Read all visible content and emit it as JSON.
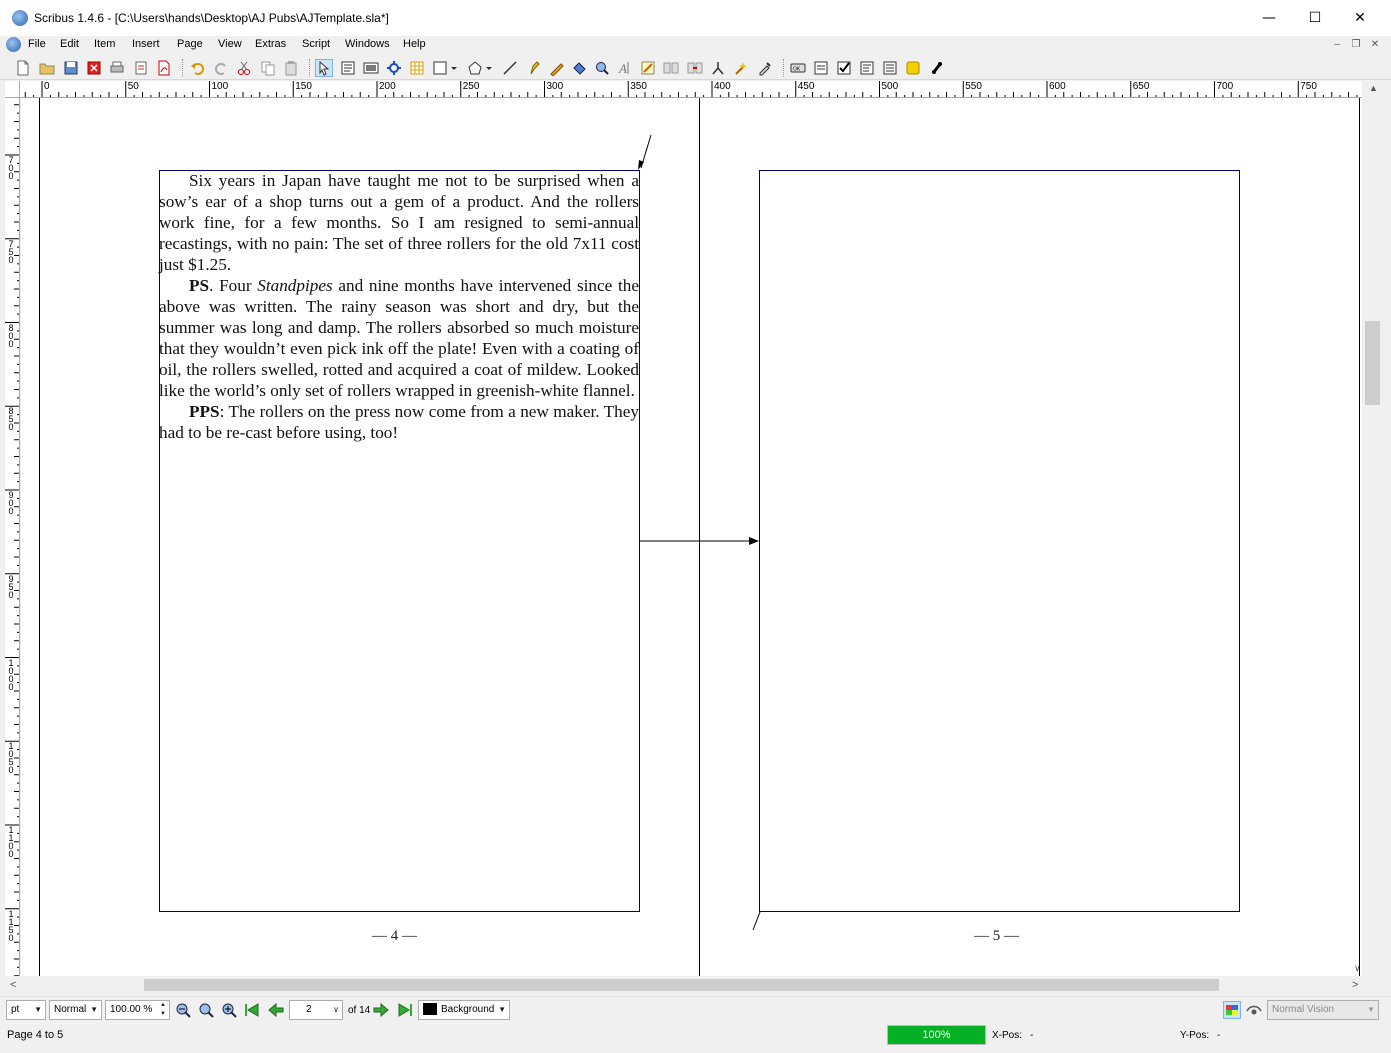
{
  "window": {
    "title": "Scribus 1.4.6 - [C:\\Users\\hands\\Desktop\\AJ Pubs\\AJTemplate.sla*]",
    "minimize_glyph": "—",
    "maximize_glyph": "☐",
    "close_glyph": "✕"
  },
  "menubar": {
    "items": [
      "File",
      "Edit",
      "Item",
      "Insert",
      "Page",
      "View",
      "Extras",
      "Script",
      "Windows",
      "Help"
    ]
  },
  "toolbar": {
    "icons": [
      "new-document-icon",
      "open-icon",
      "save-icon",
      "close-document-icon",
      "print-icon",
      "preflight-icon",
      "export-pdf-icon",
      "undo-icon",
      "redo-icon",
      "cut-icon",
      "copy-icon",
      "paste-icon",
      "select-icon",
      "text-frame-icon",
      "image-frame-icon",
      "render-frame-icon",
      "table-icon",
      "shape-icon",
      "polygon-icon",
      "line-icon",
      "bezier-icon",
      "freehand-icon",
      "rotate-icon",
      "zoom-icon",
      "edit-contents-icon",
      "edit-text-icon",
      "link-frames-icon",
      "unlink-frames-icon",
      "measure-icon",
      "copy-properties-icon",
      "eyedropper-icon",
      "pdf-button-icon",
      "pdf-textfield-icon",
      "pdf-checkbox-icon",
      "pdf-combobox-icon",
      "pdf-listbox-icon",
      "pdf-annotation-icon",
      "pdf-link-icon"
    ]
  },
  "rulers": {
    "horizontal_labels": [
      "0",
      "50",
      "100",
      "150",
      "200",
      "250",
      "300",
      "350",
      "400",
      "450",
      "500",
      "550",
      "600",
      "650",
      "700",
      "750"
    ],
    "vertical_labels": [
      "700",
      "750",
      "800",
      "850",
      "900",
      "950",
      "1000",
      "1050",
      "1100",
      "1150"
    ]
  },
  "document": {
    "paragraphs": [
      {
        "runs": [
          {
            "t": "Six years in Japan have taught me not to be surprised when a sow’s ear of a shop turns out a gem of a product. And the rollers work fine, for a few months. So I am resigned to semi-annual recastings, with no pain: The set of three rollers for the old 7x11 cost just $1.25."
          }
        ]
      },
      {
        "runs": [
          {
            "t": "PS",
            "b": true
          },
          {
            "t": ". Four "
          },
          {
            "t": "Standpipes",
            "i": true
          },
          {
            "t": " and nine months have intervened since the above was written. The rainy season was short and dry, but the summer was long and damp. The rollers absorbed so much moisture that they wouldn’t even pick ink off the plate! Even with a coating of oil, the rollers swelled, rotted and acquired a coat of mildew. Looked like the world’s only set of rollers wrapped in greenish-white flannel."
          }
        ]
      },
      {
        "runs": [
          {
            "t": "PPS",
            "b": true
          },
          {
            "t": ": The rollers on the press now come from a new maker. They had to be re-cast before using, too!"
          }
        ]
      }
    ],
    "left_page_number": "— 4 —",
    "right_page_number": "— 5 —"
  },
  "status": {
    "unit": "pt",
    "mode": "Normal",
    "zoom": "100.00 %",
    "page_input": "2",
    "page_of": "of 14",
    "layer": "Background",
    "vision": "Normal Vision",
    "page_range": "Page 4 to 5",
    "progress": "100%",
    "progress_fraction": 1.0,
    "xpos_label": "X-Pos:",
    "xpos_value": "-",
    "ypos_label": "Y-Pos:",
    "ypos_value": "-"
  },
  "colors": {
    "frame_border": "#00007a",
    "progress_green": "#06b025",
    "layer_swatch": "#000000"
  }
}
